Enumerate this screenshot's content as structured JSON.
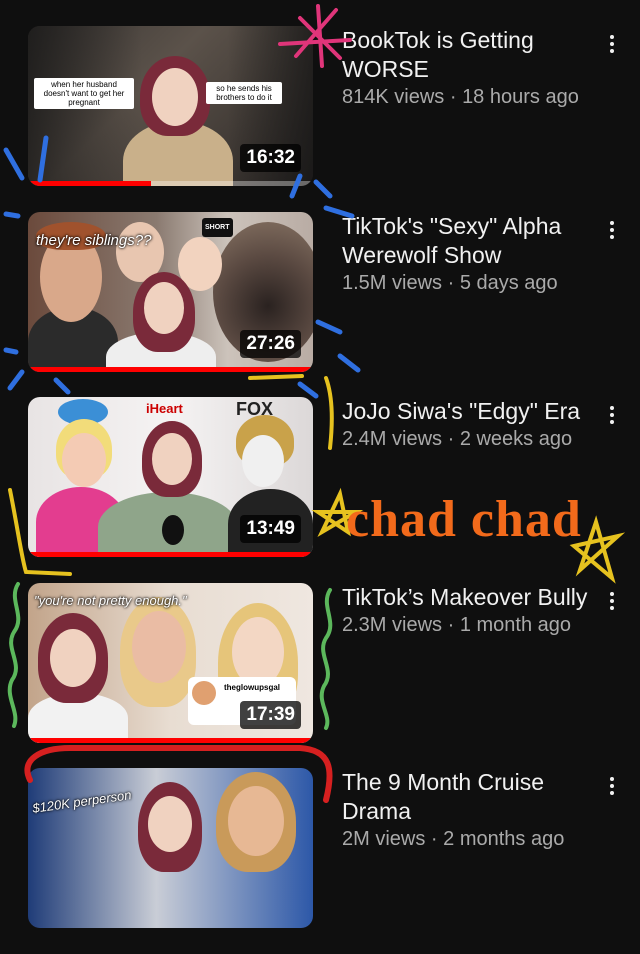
{
  "videos": [
    {
      "title": "BookTok is Getting WORSE",
      "views": "814K views",
      "age": "18 hours ago",
      "duration": "16:32",
      "progress": 0.43,
      "captions": [
        "when her husband doesn't want to get her pregnant",
        "so he sends his brothers to do it"
      ]
    },
    {
      "title": "TikTok's \"Sexy\" Alpha Werewolf Show",
      "views": "1.5M views",
      "age": "5 days ago",
      "duration": "27:26",
      "progress": 1.0,
      "overlay": "they're siblings??",
      "badge": "SHORT"
    },
    {
      "title": "JoJo Siwa's \"Edgy\" Era",
      "views": "2.4M views",
      "age": "2 weeks ago",
      "duration": "13:49",
      "progress": 1.0,
      "logos": [
        "iHeart",
        "FOX"
      ]
    },
    {
      "title": "TikTok’s Makeover Bully",
      "views": "2.3M views",
      "age": "1 month ago",
      "duration": "17:39",
      "progress": 1.0,
      "overlay": "\"you're not pretty enough.\"",
      "handle": "theglowupsgal"
    },
    {
      "title": "The 9 Month Cruise Drama",
      "views": "2M views",
      "age": "2 months ago",
      "overlay": "$120K perperson"
    }
  ],
  "annotation": "chad chad",
  "colors": {
    "background": "#0f0f0f",
    "progress": "#ff0000",
    "annotation": "#f26a1b",
    "scribble_pink": "#e0357a",
    "scribble_blue": "#2f6fe0",
    "scribble_yellow": "#e6c21f",
    "scribble_green": "#5cb85c",
    "scribble_red": "#d62020"
  },
  "icons": [
    "more-vert-icon"
  ]
}
